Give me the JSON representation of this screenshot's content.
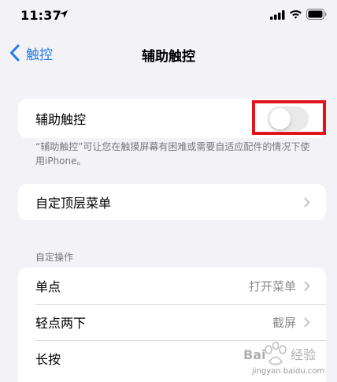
{
  "status_bar": {
    "time": "11:37"
  },
  "nav": {
    "back_label": "触控",
    "title": "辅助触控"
  },
  "assistive_touch": {
    "label": "辅助触控",
    "enabled": false,
    "footnote": "“辅助触控”可让您在触摸屏幕有困难或需要自适应配件的情况下使用iPhone。"
  },
  "top_menu": {
    "label": "自定顶层菜单"
  },
  "custom_actions": {
    "header": "自定操作",
    "rows": [
      {
        "label": "单点",
        "value": "打开菜单"
      },
      {
        "label": "轻点两下",
        "value": "截屏"
      },
      {
        "label": "长按",
        "value": ""
      }
    ]
  },
  "watermark": {
    "text": "jingyan.baidu.com"
  },
  "colors": {
    "accent": "#1f7df0",
    "highlight": "#e0141c",
    "background": "#f2f2f7"
  }
}
